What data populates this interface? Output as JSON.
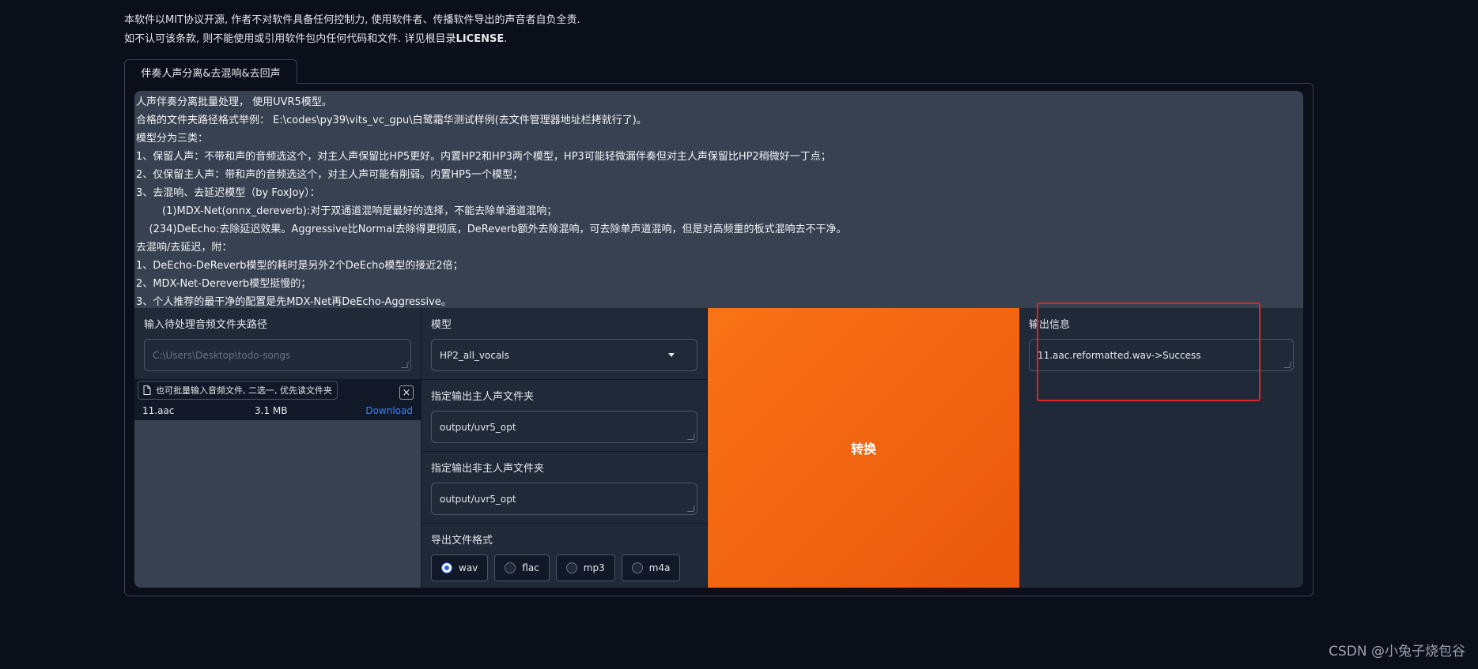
{
  "license": {
    "line1": "本软件以MIT协议开源, 作者不对软件具备任何控制力, 使用软件者、传播软件导出的声音者自负全责.",
    "line2_prefix": "如不认可该条款, 则不能使用或引用软件包内任何代码和文件. 详见根目录",
    "line2_bold": "LICENSE",
    "line2_suffix": "."
  },
  "tab": {
    "label": "伴奏人声分离&去混响&去回声"
  },
  "info_lines": [
    "人声伴奏分离批量处理， 使用UVR5模型。",
    "合格的文件夹路径格式举例： E:\\codes\\py39\\vits_vc_gpu\\白鹭霜华测试样例(去文件管理器地址栏拷就行了)。",
    "模型分为三类：",
    "1、保留人声：不带和声的音频选这个，对主人声保留比HP5更好。内置HP2和HP3两个模型，HP3可能轻微漏伴奏但对主人声保留比HP2稍微好一丁点；",
    "2、仅保留主人声：带和声的音频选这个，对主人声可能有削弱。内置HP5一个模型；",
    "3、去混响、去延迟模型（by FoxJoy）：",
    "        (1)MDX-Net(onnx_dereverb):对于双通道混响是最好的选择，不能去除单通道混响；",
    "    (234)DeEcho:去除延迟效果。Aggressive比Normal去除得更彻底，DeReverb额外去除混响，可去除单声道混响，但是对高频重的板式混响去不干净。",
    "去混响/去延迟，附：",
    "1、DeEcho-DeReverb模型的耗时是另外2个DeEcho模型的接近2倍；",
    "2、MDX-Net-Dereverb模型挺慢的；",
    "3、个人推荐的最干净的配置是先MDX-Net再DeEcho-Aggressive。"
  ],
  "input_folder": {
    "label": "输入待处理音频文件夹路径",
    "placeholder": "C:\\Users\\Desktop\\todo-songs"
  },
  "file_upload": {
    "tooltip": "也可批量输入音频文件, 二选一, 优先读文件夹",
    "close": "×",
    "files": [
      {
        "name": "11.aac",
        "size": "3.1 MB",
        "action": "Download"
      }
    ]
  },
  "model": {
    "label": "模型",
    "value": "HP2_all_vocals"
  },
  "vocal_dir": {
    "label": "指定输出主人声文件夹",
    "value": "output/uvr5_opt"
  },
  "inst_dir": {
    "label": "指定输出非主人声文件夹",
    "value": "output/uvr5_opt"
  },
  "format": {
    "label": "导出文件格式",
    "options": [
      "wav",
      "flac",
      "mp3",
      "m4a"
    ],
    "selected": "wav"
  },
  "convert": {
    "label": "转换"
  },
  "output": {
    "label": "输出信息",
    "value": "11.aac.reformatted.wav->Success"
  },
  "watermark": "CSDN @小兔子烧包谷",
  "colors": {
    "accent": "#f97316",
    "highlight_box": "#dc2626",
    "link": "#3b82f6"
  }
}
